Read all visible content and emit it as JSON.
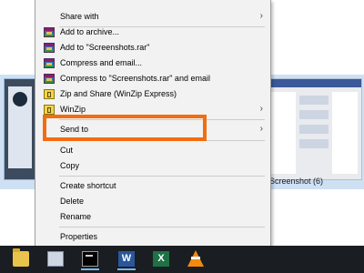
{
  "context_menu": {
    "items": [
      {
        "label": "Share with",
        "icon": "",
        "submenu": true
      },
      {
        "label": "Add to archive...",
        "icon": "winrar-icon",
        "submenu": false
      },
      {
        "label": "Add to \"Screenshots.rar\"",
        "icon": "winrar-icon",
        "submenu": false
      },
      {
        "label": "Compress and email...",
        "icon": "winrar-icon",
        "submenu": false
      },
      {
        "label": "Compress to \"Screenshots.rar\" and email",
        "icon": "winrar-icon",
        "submenu": false
      },
      {
        "label": "Zip and Share (WinZip Express)",
        "icon": "winzip-icon",
        "submenu": false
      },
      {
        "label": "WinZip",
        "icon": "winzip-icon",
        "submenu": true
      },
      {
        "label": "Send to",
        "icon": "",
        "submenu": true
      },
      {
        "label": "Cut",
        "icon": "",
        "submenu": false
      },
      {
        "label": "Copy",
        "icon": "",
        "submenu": false
      },
      {
        "label": "Create shortcut",
        "icon": "",
        "submenu": false
      },
      {
        "label": "Delete",
        "icon": "",
        "submenu": false
      },
      {
        "label": "Rename",
        "icon": "",
        "submenu": false
      },
      {
        "label": "Properties",
        "icon": "",
        "submenu": false
      }
    ],
    "submenu_arrow": "›",
    "highlighted_item": "Send to",
    "highlight_color": "#f26d10"
  },
  "explorer": {
    "thumbnail_caption": "Screenshot (6)"
  },
  "taskbar": {
    "apps": [
      {
        "name": "file-explorer-icon",
        "glyph": ""
      },
      {
        "name": "store-icon",
        "glyph": ""
      },
      {
        "name": "command-prompt-icon",
        "glyph": ""
      },
      {
        "name": "word-icon",
        "glyph": "W"
      },
      {
        "name": "excel-icon",
        "glyph": "X"
      },
      {
        "name": "vlc-icon",
        "glyph": ""
      }
    ]
  }
}
